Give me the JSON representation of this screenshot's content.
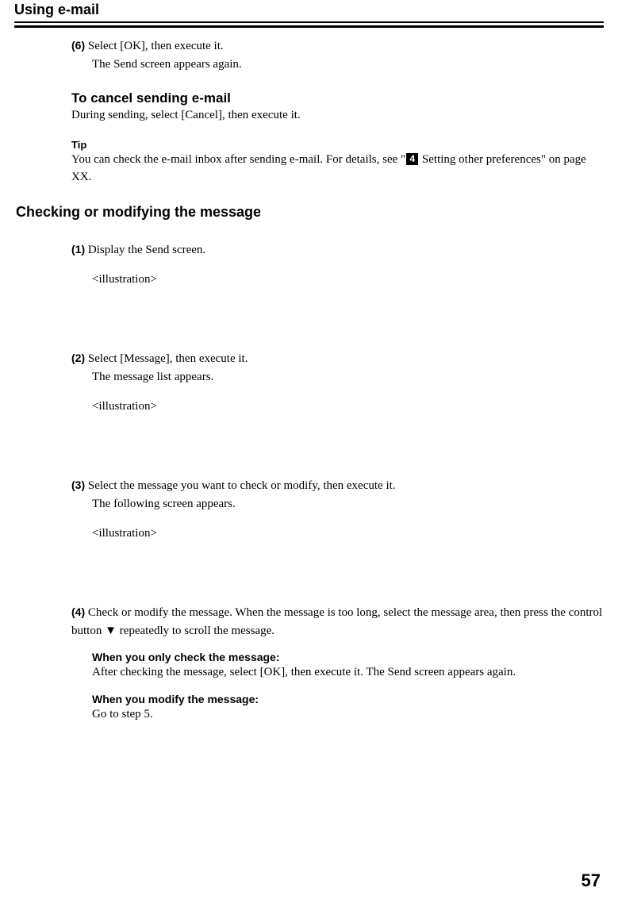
{
  "title": "Using e-mail",
  "step6": {
    "marker": "(6)",
    "line1": "Select [OK], then execute it.",
    "line2": "The Send screen appears again."
  },
  "cancel": {
    "heading": "To cancel sending e-mail",
    "body": "During sending, select [Cancel], then execute it."
  },
  "tip": {
    "label": "Tip",
    "text_before": "You can check the e-mail inbox after sending e-mail. For details, see \"",
    "badge": "4",
    "text_after": " Setting other preferences\" on page XX."
  },
  "section": "Checking or modifying the message",
  "step1": {
    "marker": "(1)",
    "line1": "Display the Send screen.",
    "illustration": "<illustration>"
  },
  "step2": {
    "marker": "(2)",
    "line1": "Select [Message], then execute it.",
    "line2": "The message list appears.",
    "illustration": "<illustration>"
  },
  "step3": {
    "marker": "(3)",
    "line1": "Select the message you want to check or modify, then execute it.",
    "line2": "The following screen appears.",
    "illustration": "<illustration>"
  },
  "step4": {
    "marker": "(4)",
    "line1": "Check or modify the message. When the message is too long, select the message area, then press the control button ▼ repeatedly to scroll the message.",
    "checkHeading": "When you only check the message:",
    "checkBody": "After checking the message, select [OK], then execute it. The Send screen appears again.",
    "modifyHeading": "When you modify the message:",
    "modifyBody": "Go to step 5."
  },
  "pageNum": "57"
}
